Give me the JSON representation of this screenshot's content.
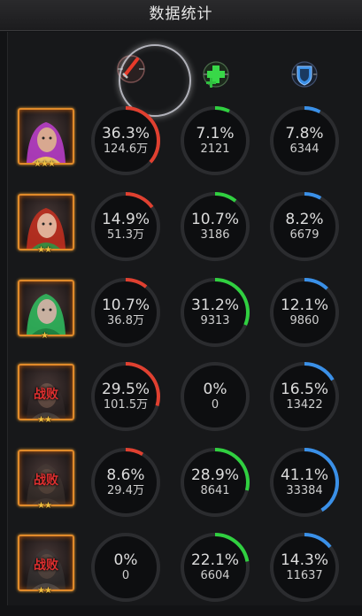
{
  "header": {
    "title": "数据统计"
  },
  "columns": [
    {
      "icon": "sword-damage-icon",
      "color": "#e04030"
    },
    {
      "icon": "healing-cross-icon",
      "color": "#30d040"
    },
    {
      "icon": "shield-defense-icon",
      "color": "#3a90e8"
    }
  ],
  "rows": [
    {
      "defeated": false,
      "defeat_label": "",
      "stars": "★★★",
      "damage": {
        "percent": "36.3%",
        "value": "124.6万",
        "fraction": 0.363
      },
      "heal": {
        "percent": "7.1%",
        "value": "2121",
        "fraction": 0.071
      },
      "tank": {
        "percent": "7.8%",
        "value": "6344",
        "fraction": 0.078
      }
    },
    {
      "defeated": false,
      "defeat_label": "",
      "stars": "★★",
      "damage": {
        "percent": "14.9%",
        "value": "51.3万",
        "fraction": 0.149
      },
      "heal": {
        "percent": "10.7%",
        "value": "3186",
        "fraction": 0.107
      },
      "tank": {
        "percent": "8.2%",
        "value": "6679",
        "fraction": 0.082
      }
    },
    {
      "defeated": false,
      "defeat_label": "",
      "stars": "★",
      "damage": {
        "percent": "10.7%",
        "value": "36.8万",
        "fraction": 0.107
      },
      "heal": {
        "percent": "31.2%",
        "value": "9313",
        "fraction": 0.312
      },
      "tank": {
        "percent": "12.1%",
        "value": "9860",
        "fraction": 0.121
      }
    },
    {
      "defeated": true,
      "defeat_label": "战败",
      "stars": "★★",
      "damage": {
        "percent": "29.5%",
        "value": "101.5万",
        "fraction": 0.295
      },
      "heal": {
        "percent": "0%",
        "value": "0",
        "fraction": 0
      },
      "tank": {
        "percent": "16.5%",
        "value": "13422",
        "fraction": 0.165
      }
    },
    {
      "defeated": true,
      "defeat_label": "战败",
      "stars": "★★",
      "damage": {
        "percent": "8.6%",
        "value": "29.4万",
        "fraction": 0.086
      },
      "heal": {
        "percent": "28.9%",
        "value": "8641",
        "fraction": 0.289
      },
      "tank": {
        "percent": "41.1%",
        "value": "33384",
        "fraction": 0.411
      }
    },
    {
      "defeated": true,
      "defeat_label": "战败",
      "stars": "★★",
      "damage": {
        "percent": "0%",
        "value": "0",
        "fraction": 0
      },
      "heal": {
        "percent": "22.1%",
        "value": "6604",
        "fraction": 0.221
      },
      "tank": {
        "percent": "14.3%",
        "value": "11637",
        "fraction": 0.143
      }
    }
  ]
}
